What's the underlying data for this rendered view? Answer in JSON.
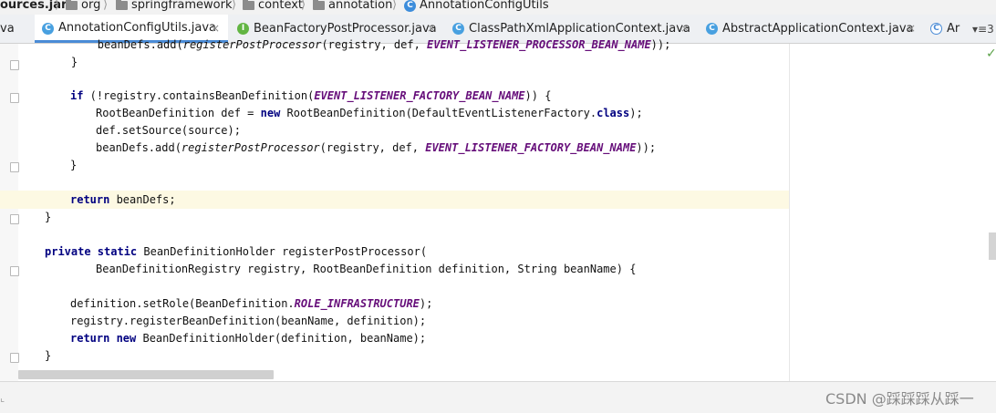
{
  "breadcrumb": {
    "jar": "ources.jar",
    "org": "org",
    "springframework": "springframework",
    "context": "context",
    "annotation": "annotation",
    "class": "AnnotationConfigUtils",
    "sep": "⟩"
  },
  "tabs": {
    "partial_left": "va",
    "t1": "AnnotationConfigUtils.java",
    "t2": "BeanFactoryPostProcessor.java",
    "t3": "ClassPathXmlApplicationContext.java",
    "t4": "AbstractApplicationContext.java",
    "t5": "Ar",
    "close": "×",
    "more": "▾≡3",
    "icon_c": "C",
    "icon_i": "I"
  },
  "code": {
    "l0a": "        beanDefs.add(",
    "l0b": "registerPostProcessor",
    "l0c": "(registry, def, ",
    "l0d": "EVENT_LISTENER_PROCESSOR_BEAN_NAME",
    "l0e": "));",
    "l1": "    }",
    "l3a": "if",
    "l3b": " (!registry.containsBeanDefinition(",
    "l3c": "EVENT_LISTENER_FACTORY_BEAN_NAME",
    "l3d": ")) {",
    "l4a": "RootBeanDefinition def = ",
    "l4b": "new",
    "l4c": " RootBeanDefinition(DefaultEventListenerFactory.",
    "l4d": "class",
    "l4e": ");",
    "l5": "def.setSource(source);",
    "l6a": "beanDefs.add(",
    "l6b": "registerPostProcessor",
    "l6c": "(registry, def, ",
    "l6d": "EVENT_LISTENER_FACTORY_BEAN_NAME",
    "l6e": "));",
    "l7": "}",
    "l9a": "return",
    "l9b": " beanDefs;",
    "l10": "}",
    "l12a": "private static",
    "l12b": " BeanDefinitionHolder registerPostProcessor(",
    "l13": "BeanDefinitionRegistry registry, RootBeanDefinition definition, String beanName) {",
    "l15a": "definition.setRole(BeanDefinition.",
    "l15b": "ROLE_INFRASTRUCTURE",
    "l15c": ");",
    "l16": "registry.registerBeanDefinition(beanName, definition);",
    "l17a": "return new",
    "l17b": " BeanDefinitionHolder(definition, beanName);",
    "l18": "}"
  },
  "status": {
    "check": "✓"
  },
  "watermark": "CSDN @踩踩踩从踩一",
  "bottom_mark": "⌞"
}
